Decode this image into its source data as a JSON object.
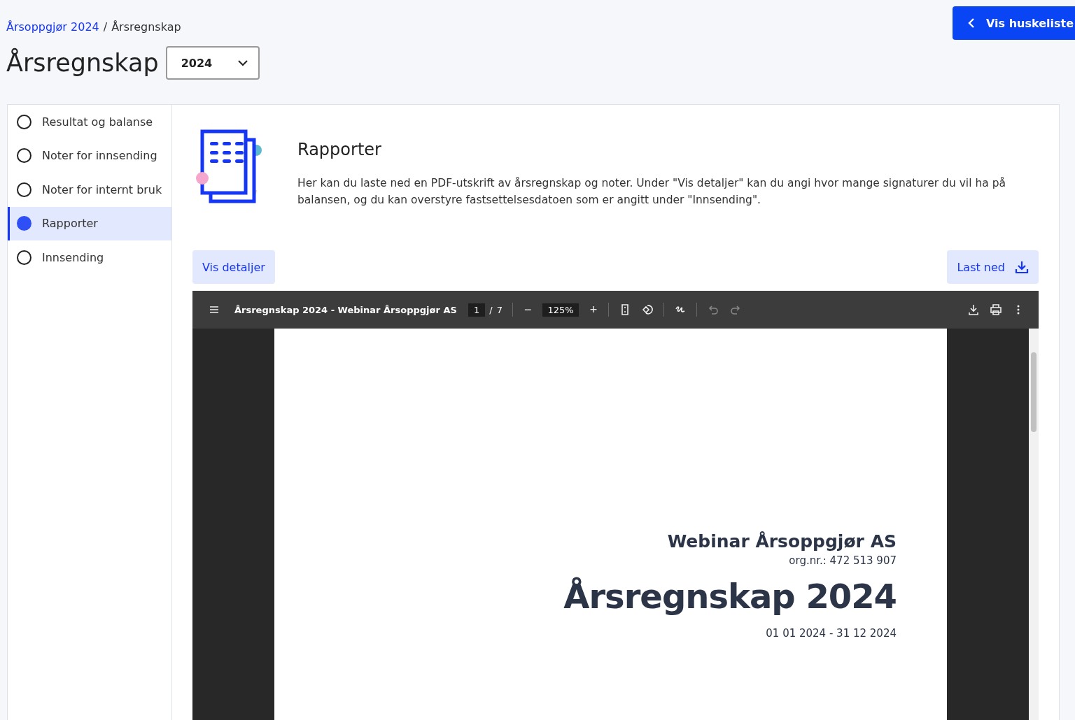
{
  "breadcrumb": [
    {
      "label": "Årsoppgjør 2024",
      "link": true
    },
    {
      "label": "Årsregnskap",
      "link": false
    }
  ],
  "breadcrumb_separator": "/",
  "reminder_button": {
    "label": "Vis huskeliste"
  },
  "title": "Årsregnskap",
  "year_select": {
    "value": "2024"
  },
  "sidebar": {
    "items": [
      {
        "label": "Resultat og balanse",
        "selected": false
      },
      {
        "label": "Noter for innsending",
        "selected": false
      },
      {
        "label": "Noter for internt bruk",
        "selected": false
      },
      {
        "label": "Rapporter",
        "selected": true
      },
      {
        "label": "Innsending",
        "selected": false
      }
    ]
  },
  "section": {
    "heading": "Rapporter",
    "description": "Her kan du laste ned en PDF-utskrift av årsregnskap og noter. Under \"Vis detaljer\" kan du angi hvor mange signaturer du vil ha på balansen, og du kan overstyre fastsettelsesdatoen som er angitt under \"Innsending\"."
  },
  "actions": {
    "details": "Vis detaljer",
    "download": "Last ned"
  },
  "pdf_viewer": {
    "title": "Årsregnskap 2024 - Webinar Årsoppgjør AS",
    "page": "1",
    "page_separator": "/",
    "page_count": "7",
    "zoom_out": "−",
    "zoom": "125%",
    "zoom_in": "+",
    "tools": [
      {
        "kind": "fit",
        "disabled": false
      },
      {
        "kind": "rotate",
        "disabled": false
      },
      {
        "kind": "sep"
      },
      {
        "kind": "draw",
        "disabled": false
      },
      {
        "kind": "sep"
      },
      {
        "kind": "undo",
        "disabled": true
      },
      {
        "kind": "redo",
        "disabled": true
      }
    ],
    "right_tools": [
      {
        "kind": "download"
      },
      {
        "kind": "print"
      },
      {
        "kind": "more"
      }
    ],
    "document": {
      "company": "Webinar Årsoppgjør AS",
      "org_number": "org.nr.: 472 513 907",
      "heading": "Årsregnskap 2024",
      "period": "01 01 2024 - 31 12 2024"
    }
  }
}
